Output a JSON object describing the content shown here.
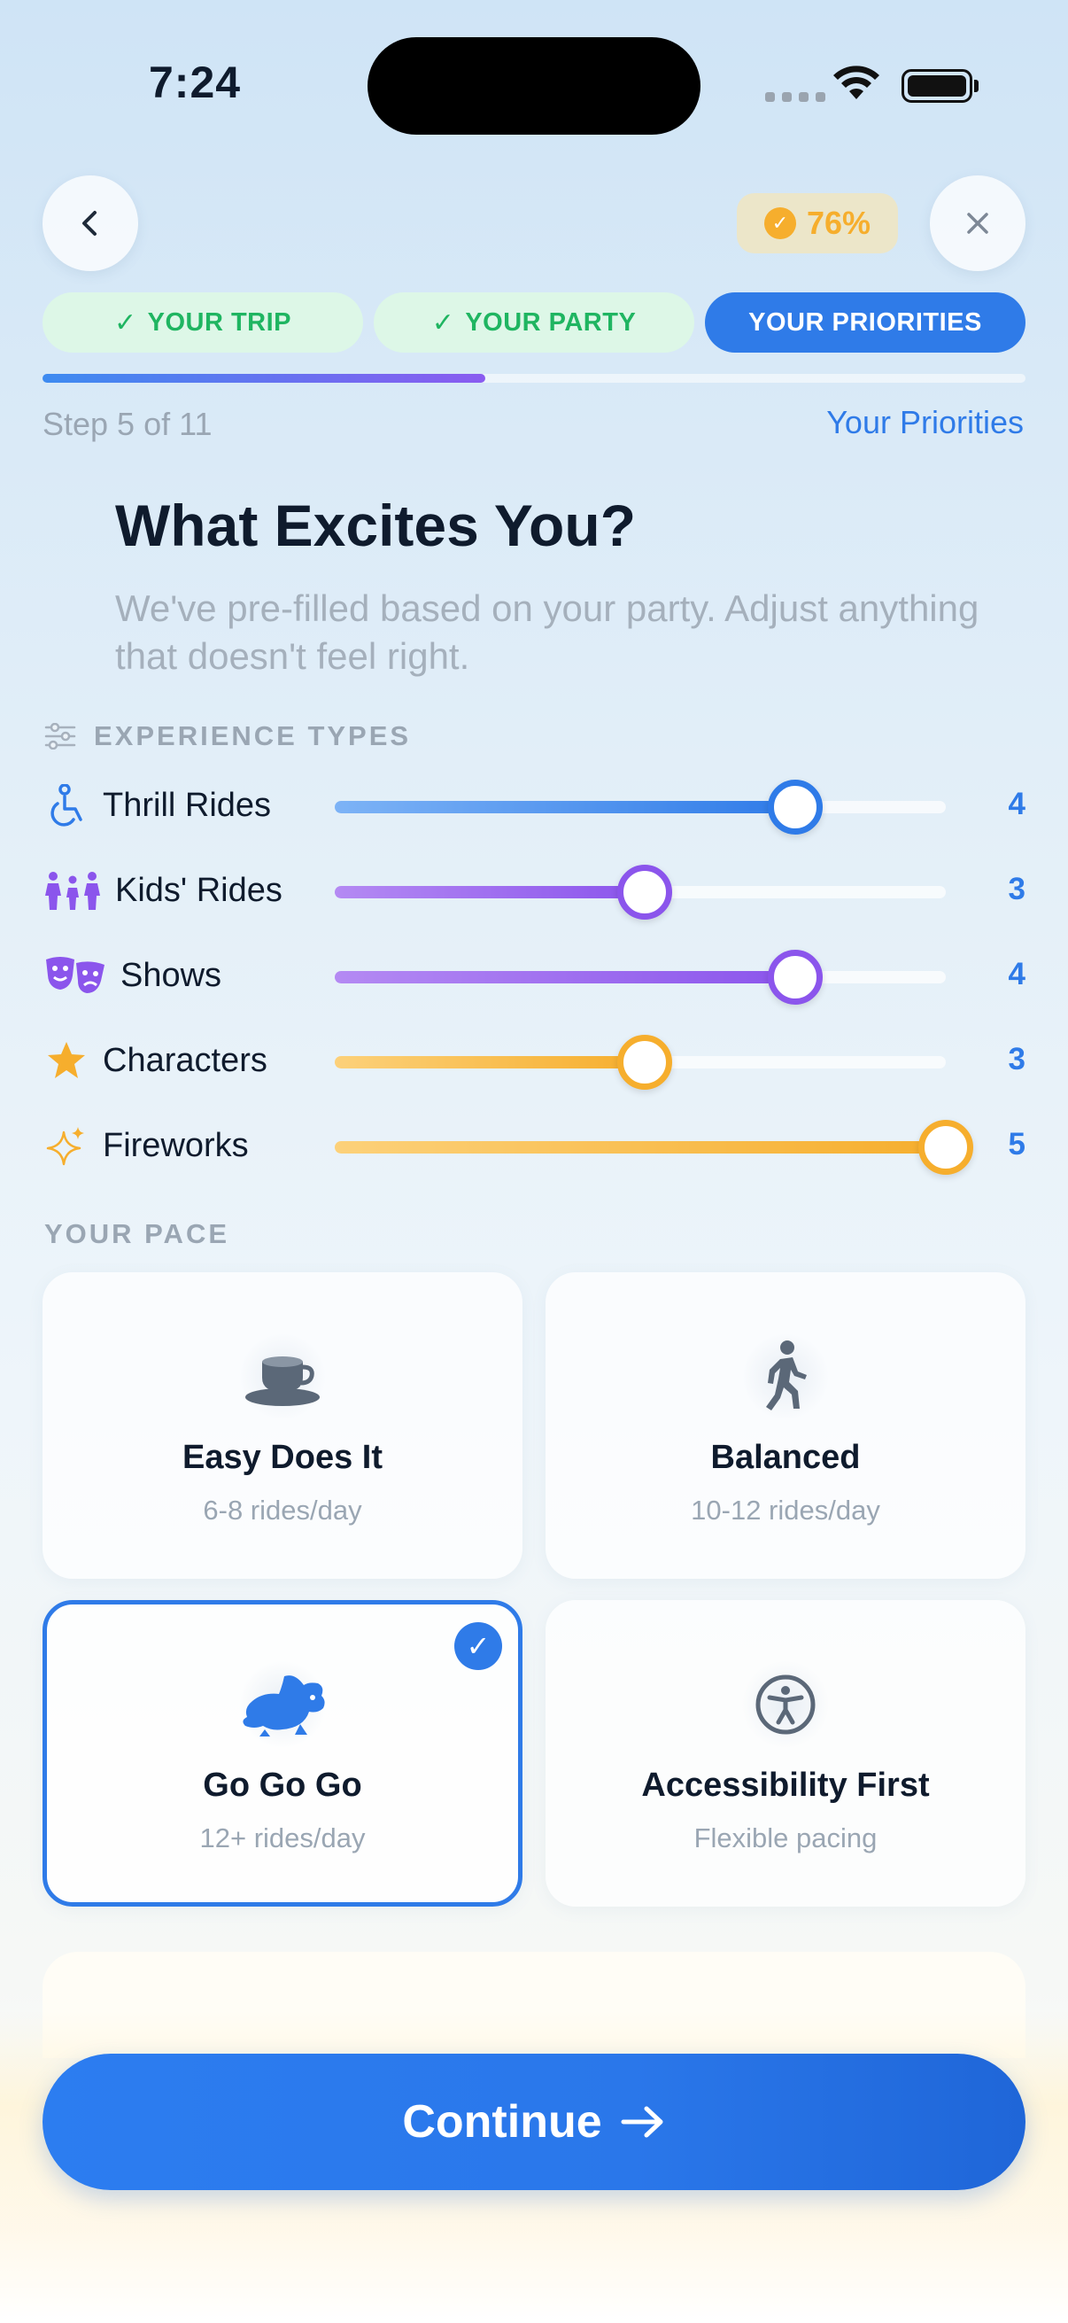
{
  "status": {
    "time": "7:24"
  },
  "header": {
    "progress": "76%",
    "progress_value": 0.76
  },
  "tabs": [
    {
      "label": "YOUR TRIP",
      "state": "done"
    },
    {
      "label": "YOUR PARTY",
      "state": "done"
    },
    {
      "label": "YOUR PRIORITIES",
      "state": "active"
    }
  ],
  "step": {
    "text": "Step 5 of 11",
    "name": "Your Priorities",
    "fraction": 0.45
  },
  "title": "What Excites You?",
  "subtitle": "We've pre-filled based on your party. Adjust anything that doesn't feel right.",
  "experience": {
    "label": "EXPERIENCE TYPES",
    "max": 5,
    "items": [
      {
        "label": "Thrill Rides",
        "value": "4",
        "level": 4,
        "icon": "thrill-rides-icon",
        "color": "#2f7be8"
      },
      {
        "label": "Kids' Rides",
        "value": "3",
        "level": 3,
        "icon": "kids-rides-icon",
        "color": "#8b55ec"
      },
      {
        "label": "Shows",
        "value": "4",
        "level": 4,
        "icon": "theater-masks-icon",
        "color": "#8b55ec"
      },
      {
        "label": "Characters",
        "value": "3",
        "level": 3,
        "icon": "star-icon",
        "color": "#f6ae2d"
      },
      {
        "label": "Fireworks",
        "value": "5",
        "level": 5,
        "icon": "sparkles-icon",
        "color": "#f6ae2d"
      }
    ]
  },
  "pace": {
    "label": "YOUR PACE",
    "options": [
      {
        "title": "Easy Does It",
        "sub": "6-8 rides/day",
        "icon": "coffee-cup-icon",
        "selected": false
      },
      {
        "title": "Balanced",
        "sub": "10-12 rides/day",
        "icon": "walking-person-icon",
        "selected": false
      },
      {
        "title": "Go Go Go",
        "sub": "12+ rides/day",
        "icon": "rabbit-icon",
        "selected": true
      },
      {
        "title": "Accessibility First",
        "sub": "Flexible pacing",
        "icon": "accessibility-icon",
        "selected": false
      }
    ]
  },
  "continue_label": "Continue"
}
